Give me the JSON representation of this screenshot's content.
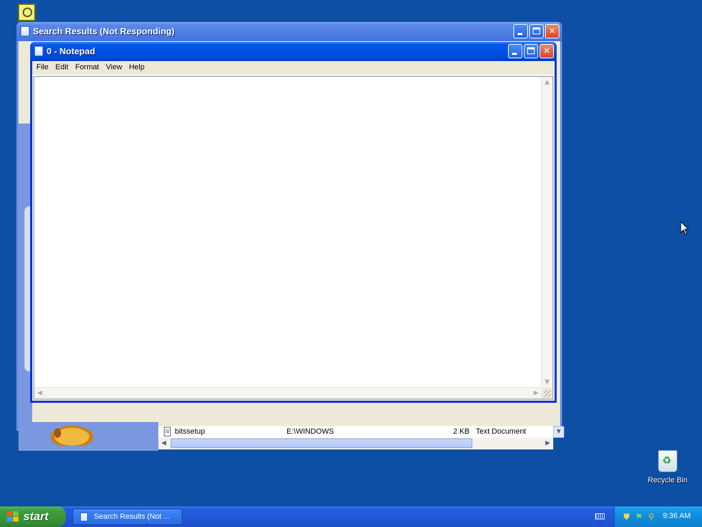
{
  "desktop": {
    "recycle_bin_label": "Recycle Bin"
  },
  "search_window": {
    "title": "Search Results (Not Responding)",
    "file_row": {
      "name": "bitssetup",
      "folder": "E:\\WINDOWS",
      "size": "2 KB",
      "type": "Text Document"
    }
  },
  "notepad": {
    "title": "0 - Notepad",
    "menu": [
      "File",
      "Edit",
      "Format",
      "View",
      "Help"
    ],
    "content": ""
  },
  "taskbar": {
    "start_label": "start",
    "items": [
      "Search Results (Not ..."
    ],
    "clock": "9:36 AM"
  },
  "colors": {
    "desktop": "#0d4fa5",
    "title_active": "#0050e6",
    "start_green": "#3c9d3c",
    "tray_blue": "#118fdf"
  }
}
